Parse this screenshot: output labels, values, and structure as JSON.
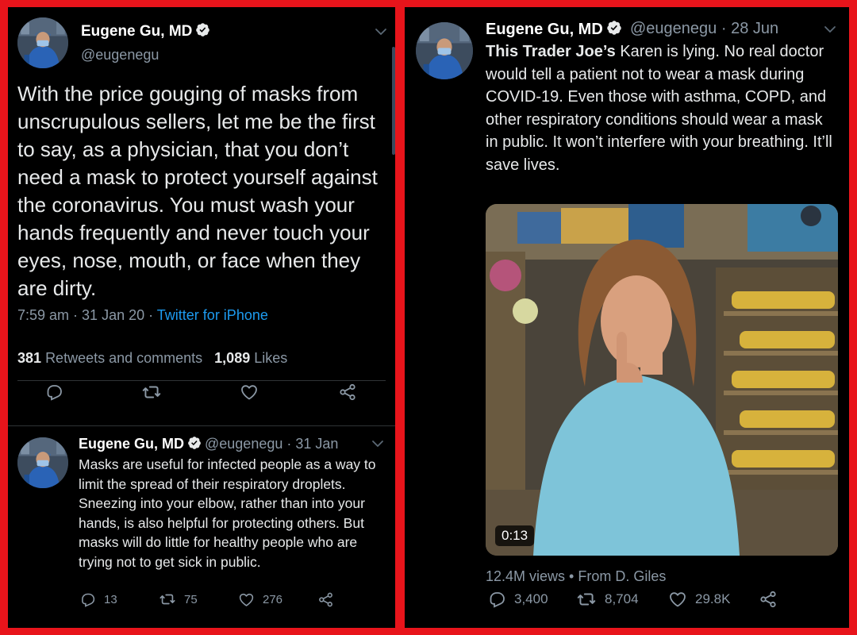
{
  "left_tweet": {
    "author": "Eugene Gu, MD",
    "handle": "@eugenegu",
    "text": "With the price gouging of masks from unscrupulous sellers, let me be the first to say, as a physician, that you don’t need a mask to protect yourself against the coronavirus. You must wash your hands frequently and never touch your eyes, nose, mouth, or face when they are dirty.",
    "time": "7:59 am",
    "date": "31 Jan 20",
    "source": "Twitter for iPhone",
    "retweets_count": "381",
    "retweets_label": "Retweets and comments",
    "likes_count": "1,089",
    "likes_label": "Likes",
    "icons": [
      "reply-icon",
      "retweet-icon",
      "like-icon",
      "share-icon"
    ]
  },
  "reply_tweet": {
    "author": "Eugene Gu, MD",
    "handle": "@eugenegu",
    "date": "31 Jan",
    "text": "Masks are useful for infected people as a way to limit the spread of their respiratory droplets. Sneezing into your elbow, rather than into your hands, is also helpful for protecting others. But masks will do little for healthy people who are trying not to get sick in public.",
    "reply_count": "13",
    "retweet_count": "75",
    "like_count": "276"
  },
  "right_tweet": {
    "author": "Eugene Gu, MD",
    "handle": "@eugenegu",
    "date": "28 Jun",
    "text_bold": "This Trader Joe’s",
    "text_rest": " Karen is lying. No real doctor would tell a patient not to wear a mask during COVID-19. Even those with asthma, COPD, and other respiratory conditions should wear a mask in public. It won’t interfere with your breathing. It’ll save lives.",
    "video_duration": "0:13",
    "views": "12.4M views",
    "attribution": "From D. Giles",
    "reply_count": "3,400",
    "retweet_count": "8,704",
    "like_count": "29.8K"
  },
  "colors": {
    "frame": "#e8141b",
    "background": "#000000",
    "text": "#e7e9ea",
    "secondary": "#8b98a5",
    "link": "#1d9bf0"
  },
  "separators": {
    "dot": " · ",
    "bullet": " • "
  }
}
